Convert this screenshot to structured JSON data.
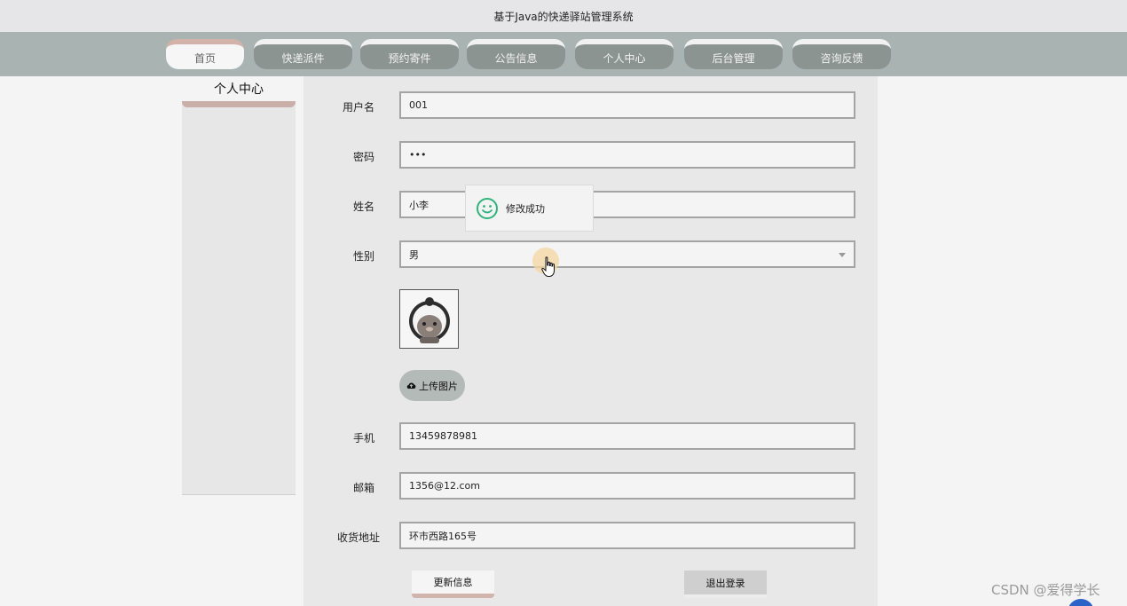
{
  "app": {
    "title": "基于Java的快递驿站管理系统"
  },
  "nav": {
    "tabs": [
      {
        "label": "首页",
        "active": true
      },
      {
        "label": "快递派件",
        "active": false
      },
      {
        "label": "预约寄件",
        "active": false
      },
      {
        "label": "公告信息",
        "active": false
      },
      {
        "label": "个人中心",
        "active": false
      },
      {
        "label": "后台管理",
        "active": false
      },
      {
        "label": "咨询反馈",
        "active": false
      }
    ]
  },
  "sidebar": {
    "title": "个人中心"
  },
  "form": {
    "username": {
      "label": "用户名",
      "value": "001"
    },
    "password": {
      "label": "密码",
      "value": "•••"
    },
    "name": {
      "label": "姓名",
      "value": "小李"
    },
    "gender": {
      "label": "性别",
      "value": "男"
    },
    "upload_label": "上传图片",
    "phone": {
      "label": "手机",
      "value": "13459878981"
    },
    "email": {
      "label": "邮箱",
      "value": "1356@12.com"
    },
    "address": {
      "label": "收货地址",
      "value": "环市西路165号"
    },
    "update_button": "更新信息",
    "logout_button": "退出登录"
  },
  "toast": {
    "message": "修改成功",
    "icon": "smile-icon",
    "color": "#2fb37b"
  },
  "watermark": "CSDN @爱得学长",
  "colors": {
    "nav_bg": "#a9b4b2",
    "tab_bg": "#8b9491",
    "accent": "#c9afa8"
  }
}
